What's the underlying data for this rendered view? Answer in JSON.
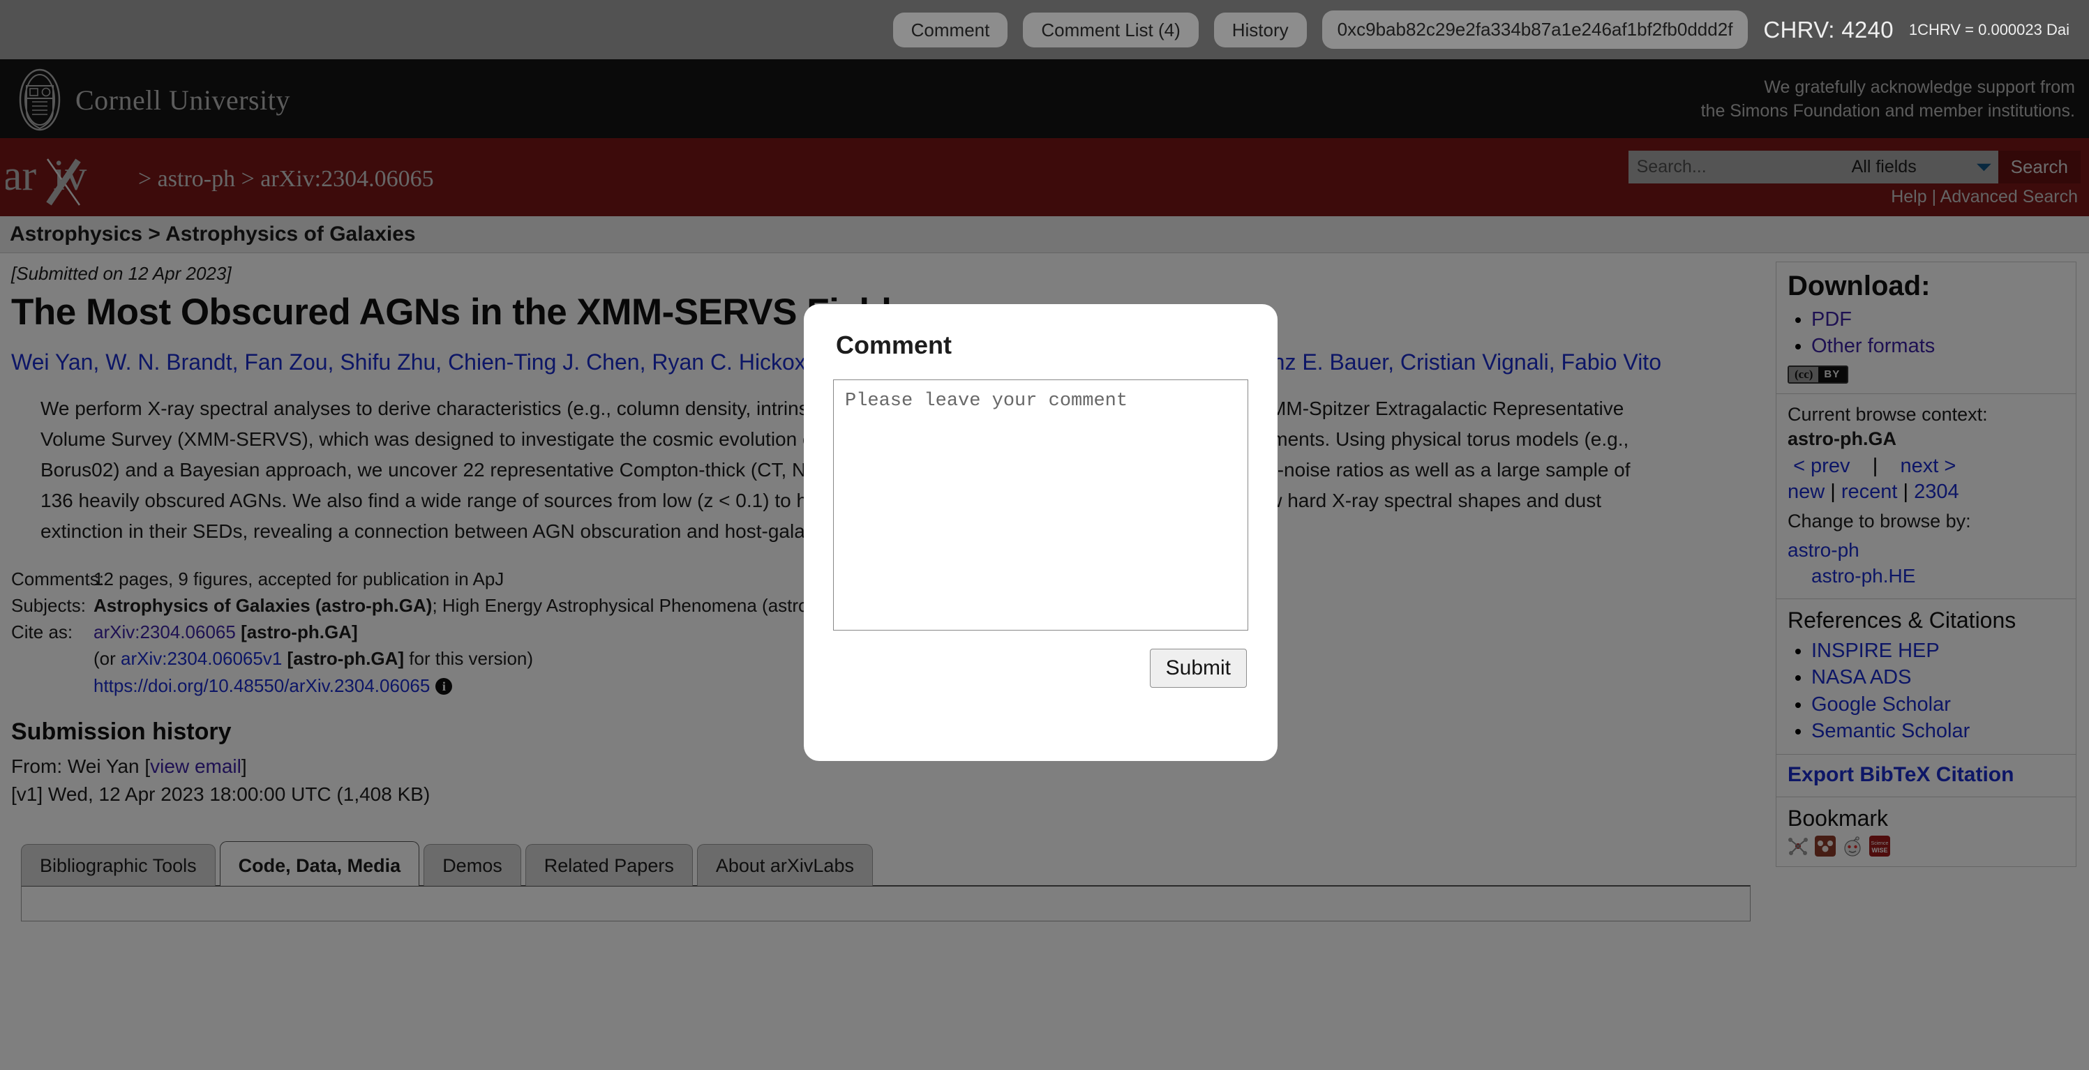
{
  "extension_bar": {
    "buttons": [
      {
        "name": "comment",
        "label": "Comment"
      },
      {
        "name": "comment-list",
        "label": "Comment List (4)"
      },
      {
        "name": "history",
        "label": "History"
      }
    ],
    "wallet_hash": "0xc9bab82c29e2fa334b87a1e246af1bf2fb0ddd2f",
    "balance_label": "CHRV: 4240",
    "rate_label": "1CHRV = 0.000023 Dai"
  },
  "cornell": {
    "name": "Cornell University",
    "support_note": "We gratefully acknowledge support from\nthe Simons Foundation and member institutions."
  },
  "arxiv_header": {
    "logo_text": "arXiv",
    "breadcrumb": "> astro-ph > arXiv:2304.06065",
    "search_placeholder": "Search...",
    "search_value": "",
    "field_selected": "All fields",
    "search_button": "Search",
    "help_link": "Help",
    "separator": "|",
    "advanced_search_link": "Advanced Search"
  },
  "subject_strip": "Astrophysics > Astrophysics of Galaxies",
  "paper": {
    "submitted": "[Submitted on 12 Apr 2023]",
    "title": "The Most Obscured AGNs in the XMM-SERVS Fields",
    "authors": "Wei Yan, W. N. Brandt, Fan Zou, Shifu Zhu, Chien-Ting J. Chen, Ryan C. Hickox, Elena Gallo, Bin Luo, David M. Alexander, Franz E. Bauer, Cristian Vignali, Fabio Vito",
    "abstract": "We perform X-ray spectral analyses to derive characteristics (e.g., column density, intrinsic luminosity) of active galactic nuclei (AGNs) in the XMM-Spitzer Extragalactic Representative Volume Survey (XMM-SERVS), which was designed to investigate the cosmic evolution of AGNs over a wide dynamic range of cosmic environments. Using physical torus models (e.g., Borus02) and a Bayesian approach, we uncover 22 representative Compton-thick (CT, NH > 1.5e24 cm−2) AGN candidates with good signal-to-noise ratios as well as a large sample of 136 heavily obscured AGNs. We also find a wide range of sources from low (z < 0.1) to high (z > 0.75) redshift. Our CT candidates tend to show hard X-ray spectral shapes and dust extinction in their SEDs, revealing a connection between AGN obscuration and host-galaxy evolution.",
    "meta": {
      "comments_label": "Comments:",
      "comments_value": "12 pages, 9 figures, accepted for publication in ApJ",
      "subjects_label": "Subjects:",
      "subjects_primary": "Astrophysics of Galaxies (astro-ph.GA)",
      "subjects_rest": "; High Energy Astrophysical Phenomena (astro-ph.HE)",
      "cite_label": "Cite as:",
      "cite_id": "arXiv:2304.06065",
      "cite_cat": "[astro-ph.GA]",
      "version_prefix": "(or ",
      "version_id": "arXiv:2304.06065v1",
      "version_cat": "[astro-ph.GA]",
      "version_suffix": " for this version)",
      "doi": "https://doi.org/10.48550/arXiv.2304.06065",
      "info_icon": "i"
    },
    "submission_history": {
      "heading": "Submission history",
      "from_prefix": "From: Wei Yan [",
      "view_email": "view email",
      "from_suffix": "]",
      "version_line": "[v1] Wed, 12 Apr 2023 18:00:00 UTC (1,408 KB)"
    }
  },
  "tabs": [
    {
      "label": "Bibliographic Tools",
      "active": false
    },
    {
      "label": "Code, Data, Media",
      "active": true
    },
    {
      "label": "Demos",
      "active": false
    },
    {
      "label": "Related Papers",
      "active": false
    },
    {
      "label": "About arXivLabs",
      "active": false
    }
  ],
  "sidebar": {
    "download_heading": "Download:",
    "download_links": [
      "PDF",
      "Other formats"
    ],
    "license_badge_left": "(cc)",
    "license_badge_right": "BY",
    "browse_context_label": "Current browse context:",
    "browse_context_value": "astro-ph.GA",
    "prev_link": "< prev",
    "nav_sep": "|",
    "next_link": "next >",
    "nav_new": "new",
    "nav_recent": "recent",
    "nav_month": "2304",
    "change_browse_label": "Change to browse by:",
    "browse_links": [
      "astro-ph",
      "astro-ph.HE"
    ],
    "refs_heading": "References & Citations",
    "refs_links": [
      "INSPIRE HEP",
      "NASA ADS",
      "Google Scholar",
      "Semantic Scholar"
    ],
    "export_link": "Export BibTeX Citation",
    "bookmark_heading": "Bookmark",
    "bookmark_icons": [
      "bibsonomy-icon",
      "mendeley-icon",
      "reddit-icon",
      "sciencewise-icon"
    ]
  },
  "modal": {
    "title": "Comment",
    "textarea_placeholder": "Please leave your comment",
    "textarea_value": "",
    "submit_label": "Submit"
  },
  "colors": {
    "arxiv_maroon": "#7b1616",
    "cornell_black": "#151515",
    "link_blue": "#1a2ccc",
    "link_purple": "#3d23a5",
    "extension_bar": "#525252"
  }
}
